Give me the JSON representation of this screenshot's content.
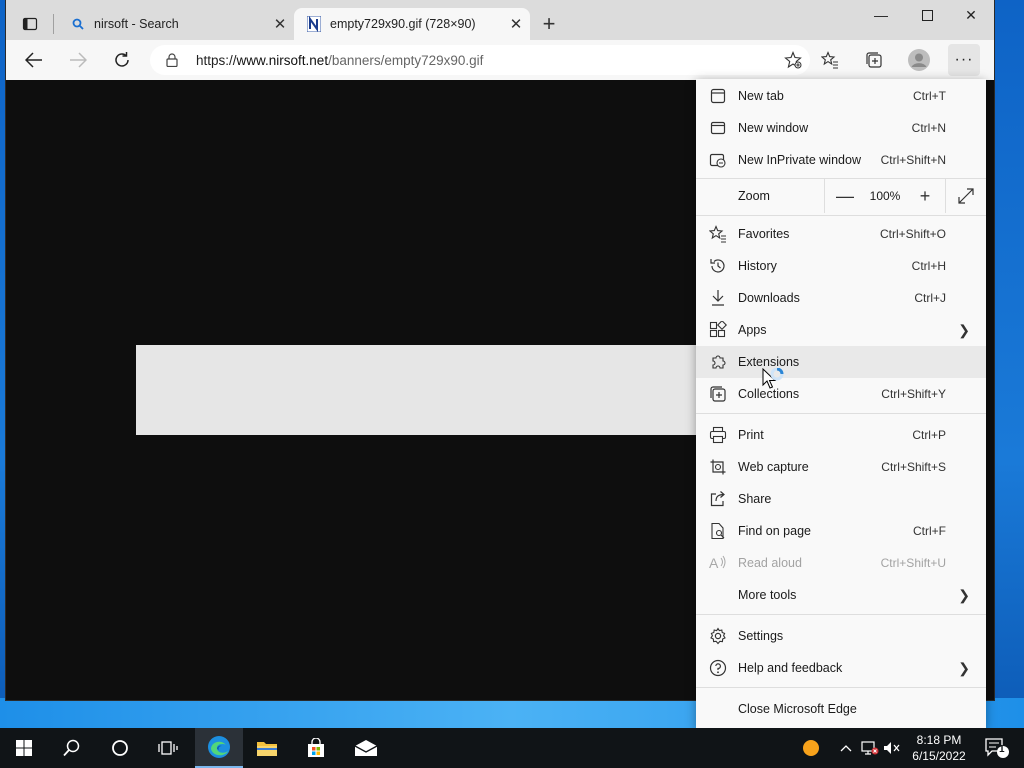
{
  "browser": {
    "tabs": [
      {
        "title": "nirsoft - Search",
        "active": false
      },
      {
        "title": "empty729x90.gif (728×90)",
        "active": true
      }
    ],
    "address_bar": {
      "scheme": "https://",
      "host": "www.nirsoft.net",
      "path": "/banners/empty729x90.gif"
    }
  },
  "menu": {
    "items_top": [
      {
        "label": "New tab",
        "shortcut": "Ctrl+T",
        "icon": "new-tab-icon"
      },
      {
        "label": "New window",
        "shortcut": "Ctrl+N",
        "icon": "new-window-icon"
      },
      {
        "label": "New InPrivate window",
        "shortcut": "Ctrl+Shift+N",
        "icon": "inprivate-icon"
      }
    ],
    "zoom": {
      "label": "Zoom",
      "value": "100%"
    },
    "items_mid": [
      {
        "label": "Favorites",
        "shortcut": "Ctrl+Shift+O",
        "icon": "favorites-icon"
      },
      {
        "label": "History",
        "shortcut": "Ctrl+H",
        "icon": "history-icon"
      },
      {
        "label": "Downloads",
        "shortcut": "Ctrl+J",
        "icon": "download-icon"
      },
      {
        "label": "Apps",
        "shortcut": "",
        "icon": "apps-icon",
        "submenu": true
      },
      {
        "label": "Extensions",
        "shortcut": "",
        "icon": "extensions-icon",
        "hover": true
      },
      {
        "label": "Collections",
        "shortcut": "Ctrl+Shift+Y",
        "icon": "collections-icon"
      }
    ],
    "items_tools": [
      {
        "label": "Print",
        "shortcut": "Ctrl+P",
        "icon": "print-icon"
      },
      {
        "label": "Web capture",
        "shortcut": "Ctrl+Shift+S",
        "icon": "web-capture-icon"
      },
      {
        "label": "Share",
        "shortcut": "",
        "icon": "share-icon"
      },
      {
        "label": "Find on page",
        "shortcut": "Ctrl+F",
        "icon": "find-icon"
      },
      {
        "label": "Read aloud",
        "shortcut": "Ctrl+Shift+U",
        "icon": "read-aloud-icon",
        "disabled": true
      },
      {
        "label": "More tools",
        "shortcut": "",
        "icon": "",
        "submenu": true
      }
    ],
    "items_help": [
      {
        "label": "Settings",
        "shortcut": "",
        "icon": "settings-icon"
      },
      {
        "label": "Help and feedback",
        "shortcut": "",
        "icon": "help-icon",
        "submenu": true
      }
    ],
    "close_label": "Close Microsoft Edge"
  },
  "taskbar": {
    "clock_time": "8:18 PM",
    "clock_date": "6/15/2022",
    "notification_count": "1"
  },
  "colors": {
    "accent": "#0078d4",
    "taskbar": "#101417",
    "menu_bg": "#f9f9f9"
  }
}
